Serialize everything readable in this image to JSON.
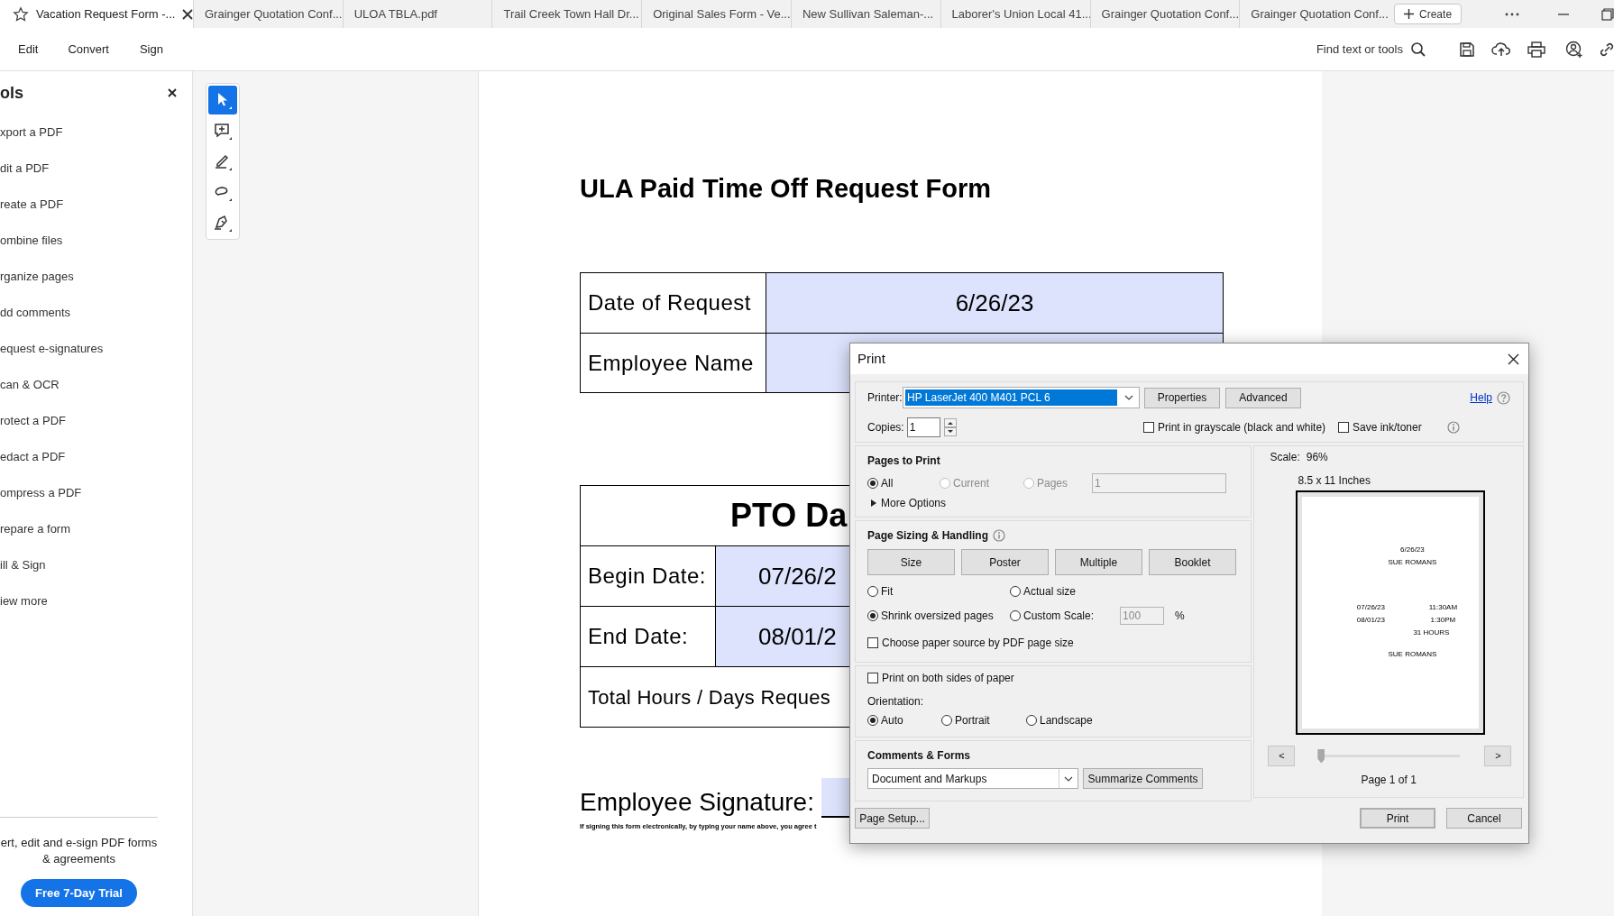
{
  "tabs": [
    {
      "label": "Vacation Request Form -...",
      "selected": true
    },
    {
      "label": "Grainger Quotation Conf...",
      "selected": false
    },
    {
      "label": "ULOA TBLA.pdf",
      "selected": false
    },
    {
      "label": "Trail Creek Town Hall Dr...",
      "selected": false
    },
    {
      "label": "Original Sales Form - Ve...",
      "selected": false
    },
    {
      "label": "New Sullivan Saleman-...",
      "selected": false
    },
    {
      "label": "Laborer's Union Local 41...",
      "selected": false
    },
    {
      "label": "Grainger Quotation Conf...",
      "selected": false
    },
    {
      "label": "Grainger Quotation Conf...",
      "selected": false
    }
  ],
  "create_button": "Create",
  "menu": [
    "Edit",
    "Convert",
    "Sign"
  ],
  "find_tools": "Find text or tools",
  "tools_panel": {
    "title": "ols",
    "items": [
      "xport a PDF",
      "dit a PDF",
      "reate a PDF",
      "ombine files",
      "rganize pages",
      "dd comments",
      "equest e-signatures",
      "can & OCR",
      "rotect a PDF",
      "edact a PDF",
      "ompress a PDF",
      "repare a form",
      "ill & Sign",
      "iew more"
    ],
    "promo": "ert, edit and e-sign PDF forms & agreements",
    "trial_button": "Free 7-Day Trial"
  },
  "toolbar": [
    {
      "kind": "select",
      "selected": true
    },
    {
      "kind": "comment",
      "selected": false
    },
    {
      "kind": "highlight",
      "selected": false
    },
    {
      "kind": "lasso",
      "selected": false
    },
    {
      "kind": "sign",
      "selected": false
    }
  ],
  "document": {
    "title": "ULA Paid Time Off Request Form",
    "request_rows": [
      {
        "label": "Date of Request",
        "value": "6/26/23"
      },
      {
        "label": "Employee Name"
      }
    ],
    "pto_heading": "PTO Da",
    "pto_rows": [
      {
        "label": "Begin Date:",
        "value": "07/26/2"
      },
      {
        "label": "End Date:",
        "value": "08/01/2"
      }
    ],
    "total_label": "Total Hours / Days Reques",
    "signature_label": "Employee Signature:",
    "signature_note": "If signing this form electronically, by typing your name above, you agree t"
  },
  "print_dialog": {
    "title": "Print",
    "printer_label": "Printer:",
    "printer": "HP LaserJet 400 M401 PCL 6",
    "properties_button": "Properties",
    "advanced_button": "Advanced",
    "help_link": "Help",
    "copies_label": "Copies:",
    "copies": "1",
    "options": [
      {
        "label": "Print in grayscale (black and white)",
        "checked": false
      },
      {
        "label": "Save ink/toner",
        "checked": false
      }
    ],
    "pages_to_print": {
      "title": "Pages to Print",
      "choices": [
        {
          "label": "All",
          "selected": true,
          "disabled": false
        },
        {
          "label": "Current",
          "selected": false,
          "disabled": true
        },
        {
          "label": "Pages",
          "selected": false,
          "disabled": true
        }
      ],
      "pages_value": "1",
      "more_options": "More Options"
    },
    "page_sizing": {
      "title": "Page Sizing & Handling",
      "modes": [
        "Size",
        "Poster",
        "Multiple",
        "Booklet"
      ],
      "fit_choices": [
        {
          "label": "Fit",
          "selected": false
        },
        {
          "label": "Actual size",
          "selected": false
        },
        {
          "label": "Shrink oversized pages",
          "selected": true
        },
        {
          "label": "Custom Scale:",
          "selected": false
        }
      ],
      "custom_scale": "100",
      "percent": "%",
      "paper_source": {
        "label": "Choose paper source by PDF page size",
        "checked": false
      }
    },
    "both_sides": {
      "label": "Print on both sides of paper",
      "checked": false
    },
    "orientation": {
      "title": "Orientation:",
      "choices": [
        {
          "label": "Auto",
          "selected": true
        },
        {
          "label": "Portrait",
          "selected": false
        },
        {
          "label": "Landscape",
          "selected": false
        }
      ]
    },
    "comments_forms": {
      "title": "Comments & Forms",
      "value": "Document and Markups",
      "summarize_button": "Summarize Comments"
    },
    "preview": {
      "scale_label": "Scale:",
      "scale": "96%",
      "paper": "8.5 x 11 Inches",
      "page_lines": [
        "6/26/23",
        "SUE ROMANS",
        "07/26/23",
        "11:30AM",
        "08/01/23",
        "1:30PM",
        "31 HOURS",
        "SUE ROMANS"
      ],
      "slider": {
        "level": 0
      },
      "prev": "<",
      "next": ">",
      "page_count": "Page 1 of 1"
    },
    "page_setup_button": "Page Setup...",
    "print_button": "Print",
    "cancel_button": "Cancel"
  }
}
